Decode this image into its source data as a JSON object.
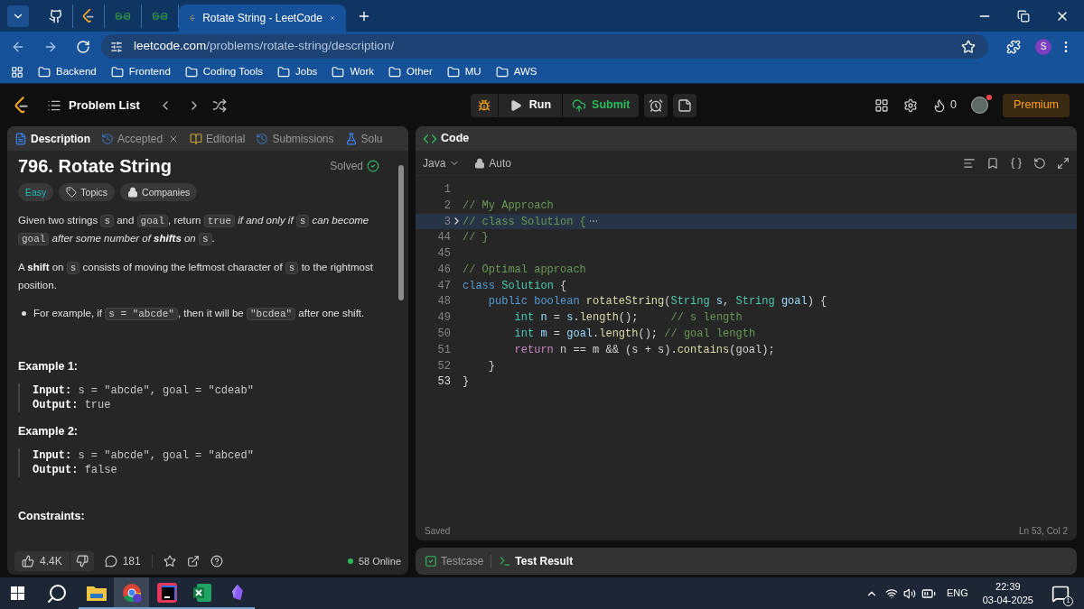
{
  "browser": {
    "tabs": [
      {
        "kind": "github",
        "selected": false
      },
      {
        "kind": "leetcode",
        "selected": false
      },
      {
        "kind": "geeks",
        "selected": false
      },
      {
        "kind": "geeks",
        "selected": false
      },
      {
        "kind": "leetcode",
        "title": "Rotate String - LeetCode",
        "selected": true
      }
    ],
    "address": {
      "domain": "leetcode.com",
      "path": "/problems/rotate-string/description/"
    },
    "profile": "S",
    "bookmarks": [
      "Backend",
      "Frontend",
      "Coding Tools",
      "Jobs",
      "Work",
      "Other",
      "MU",
      "AWS"
    ]
  },
  "header": {
    "problem_list": "Problem List",
    "run": "Run",
    "submit": "Submit",
    "streak": "0",
    "premium": "Premium"
  },
  "left_tabs": [
    {
      "label": "Description",
      "kind": "doc",
      "closable": false,
      "selected": true
    },
    {
      "label": "Accepted",
      "kind": "history",
      "closable": true,
      "selected": false
    },
    {
      "label": "Editorial",
      "kind": "book",
      "closable": false,
      "selected": false
    },
    {
      "label": "Submissions",
      "kind": "history",
      "closable": false,
      "selected": false
    },
    {
      "label": "Solu",
      "kind": "flask",
      "closable": false,
      "selected": false
    }
  ],
  "problem": {
    "title": "796. Rotate String",
    "status": "Solved",
    "tags": [
      {
        "label": "Easy",
        "kind": "difficulty"
      },
      {
        "label": "Topics",
        "kind": "topics"
      },
      {
        "label": "Companies",
        "kind": "companies"
      }
    ],
    "paragraphs": [
      {
        "kind": "para",
        "segments": [
          {
            "text": "Given two strings ",
            "kind": "text"
          },
          {
            "text": "s",
            "kind": "code"
          },
          {
            "text": " and ",
            "kind": "text"
          },
          {
            "text": "goal",
            "kind": "code"
          },
          {
            "text": ", return ",
            "kind": "text"
          },
          {
            "text": "true",
            "kind": "code"
          },
          {
            "text": " if and only if ",
            "kind": "em"
          },
          {
            "text": "s",
            "kind": "code"
          },
          {
            "text": " can become ",
            "kind": "em"
          },
          {
            "text": "goal",
            "kind": "code"
          },
          {
            "text": " after some number of ",
            "kind": "em"
          },
          {
            "text": "shifts",
            "kind": "strongem"
          },
          {
            "text": " on ",
            "kind": "em"
          },
          {
            "text": "s",
            "kind": "code"
          },
          {
            "text": ".",
            "kind": "text"
          }
        ]
      },
      {
        "kind": "para",
        "segments": [
          {
            "text": "A ",
            "kind": "text"
          },
          {
            "text": "shift",
            "kind": "strong"
          },
          {
            "text": " on ",
            "kind": "text"
          },
          {
            "text": "s",
            "kind": "code"
          },
          {
            "text": " consists of moving the leftmost character of ",
            "kind": "text"
          },
          {
            "text": "s",
            "kind": "code"
          },
          {
            "text": " to the rightmost position.",
            "kind": "text"
          }
        ]
      },
      {
        "kind": "bullet",
        "segments": [
          {
            "text": "For example, if ",
            "kind": "text"
          },
          {
            "text": "s = \"abcde\"",
            "kind": "code"
          },
          {
            "text": ", then it will be ",
            "kind": "text"
          },
          {
            "text": "\"bcdea\"",
            "kind": "code"
          },
          {
            "text": " after one shift.",
            "kind": "text"
          }
        ]
      }
    ],
    "examples": [
      {
        "title": "Example 1:",
        "input_label": "Input:",
        "input": "s = \"abcde\", goal = \"cdeab\"",
        "output_label": "Output:",
        "output": "true"
      },
      {
        "title": "Example 2:",
        "input_label": "Input:",
        "input": "s = \"abcde\", goal = \"abced\"",
        "output_label": "Output:",
        "output": "false"
      }
    ],
    "constraints": "Constraints:"
  },
  "left_footer": {
    "likes": "4.4K",
    "comments": "181",
    "online": "58 Online"
  },
  "editor": {
    "title": "Code",
    "language": "Java",
    "mode": "Auto",
    "lines": [
      {
        "number": "1",
        "highlighted": false,
        "folded": false
      },
      {
        "number": "2",
        "highlighted": false,
        "folded": false,
        "tokens": [
          {
            "text": "// My Approach",
            "kind": "comment"
          }
        ]
      },
      {
        "number": "3",
        "highlighted": true,
        "folded": true,
        "tokens": [
          {
            "text": "// class Solution {",
            "kind": "comment"
          }
        ]
      },
      {
        "number": "44",
        "highlighted": false,
        "folded": false,
        "tokens": [
          {
            "text": "// }",
            "kind": "comment"
          }
        ]
      },
      {
        "number": "45",
        "highlighted": false,
        "folded": false
      },
      {
        "number": "46",
        "highlighted": false,
        "folded": false,
        "tokens": [
          {
            "text": "// Optimal approach",
            "kind": "comment"
          }
        ]
      },
      {
        "number": "47",
        "highlighted": false,
        "folded": false,
        "tokens": [
          {
            "text": "class",
            "kind": "keyword"
          },
          {
            "text": " Solution",
            "kind": "type"
          },
          {
            "text": " {",
            "kind": "plain"
          }
        ]
      },
      {
        "number": "48",
        "highlighted": false,
        "folded": false,
        "tokens": [
          {
            "text": "    public",
            "kind": "keyword"
          },
          {
            "text": " boolean",
            "kind": "keyword"
          },
          {
            "text": " rotateString",
            "kind": "function"
          },
          {
            "text": "(",
            "kind": "plain"
          },
          {
            "text": "String",
            "kind": "type"
          },
          {
            "text": " s",
            "kind": "variable"
          },
          {
            "text": ",",
            "kind": "plain"
          },
          {
            "text": " String",
            "kind": "type"
          },
          {
            "text": " goal",
            "kind": "variable"
          },
          {
            "text": ") {",
            "kind": "plain"
          }
        ]
      },
      {
        "number": "49",
        "highlighted": false,
        "folded": false,
        "tokens": [
          {
            "text": "        int",
            "kind": "type"
          },
          {
            "text": " n",
            "kind": "variable"
          },
          {
            "text": " = ",
            "kind": "plain"
          },
          {
            "text": "s",
            "kind": "variable"
          },
          {
            "text": ".",
            "kind": "plain"
          },
          {
            "text": "length",
            "kind": "function"
          },
          {
            "text": "();     ",
            "kind": "plain"
          },
          {
            "text": "// s length",
            "kind": "comment"
          }
        ]
      },
      {
        "number": "50",
        "highlighted": false,
        "folded": false,
        "tokens": [
          {
            "text": "        int",
            "kind": "type"
          },
          {
            "text": " m",
            "kind": "variable"
          },
          {
            "text": " = ",
            "kind": "plain"
          },
          {
            "text": "goal",
            "kind": "variable"
          },
          {
            "text": ".",
            "kind": "plain"
          },
          {
            "text": "length",
            "kind": "function"
          },
          {
            "text": "(); ",
            "kind": "plain"
          },
          {
            "text": "// goal length",
            "kind": "comment"
          }
        ]
      },
      {
        "number": "51",
        "highlighted": false,
        "folded": false,
        "tokens": [
          {
            "text": "        return",
            "kind": "control"
          },
          {
            "text": " n == m && (s + s).",
            "kind": "plain"
          },
          {
            "text": "contains",
            "kind": "function"
          },
          {
            "text": "(goal);",
            "kind": "plain"
          }
        ]
      },
      {
        "number": "52",
        "highlighted": false,
        "folded": false,
        "tokens": [
          {
            "text": "    }",
            "kind": "plain"
          }
        ]
      },
      {
        "number": "53",
        "highlighted": false,
        "folded": false,
        "tokens": [
          {
            "text": "}",
            "kind": "plain"
          }
        ]
      }
    ],
    "status": "Saved",
    "cursor": "Ln 53, Col 2"
  },
  "bottom_tabs": [
    {
      "label": "Testcase",
      "kind": "check",
      "selected": false
    },
    {
      "label": "Test Result",
      "kind": "terminal",
      "selected": true
    }
  ],
  "taskbar": {
    "apps": [
      {
        "kind": "files",
        "selected": false
      },
      {
        "kind": "chrome",
        "selected": true
      },
      {
        "kind": "intellij",
        "selected": false
      },
      {
        "kind": "excel",
        "selected": false
      },
      {
        "kind": "obsidian",
        "selected": false
      }
    ],
    "language": "ENG",
    "time": "22:39",
    "date": "03-04-2025",
    "notifications": "1"
  }
}
